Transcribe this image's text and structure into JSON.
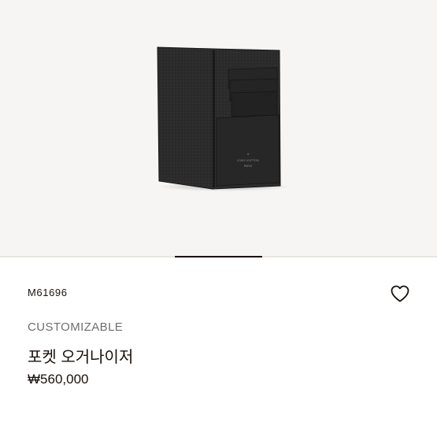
{
  "product": {
    "sku": "M61696",
    "tag": "CUSTOMIZABLE",
    "title": "포켓 오거나이저",
    "price": "₩560,000",
    "embossing": [
      "LOUIS VUITTON",
      "PARIS"
    ]
  },
  "wishlist": {
    "icon": "heart-outline-icon"
  },
  "carousel": {
    "active_index": 2,
    "count": 5
  },
  "colors": {
    "background": "#f6f5f3",
    "text": "#19110b",
    "muted_text": "#6f6f6f"
  }
}
